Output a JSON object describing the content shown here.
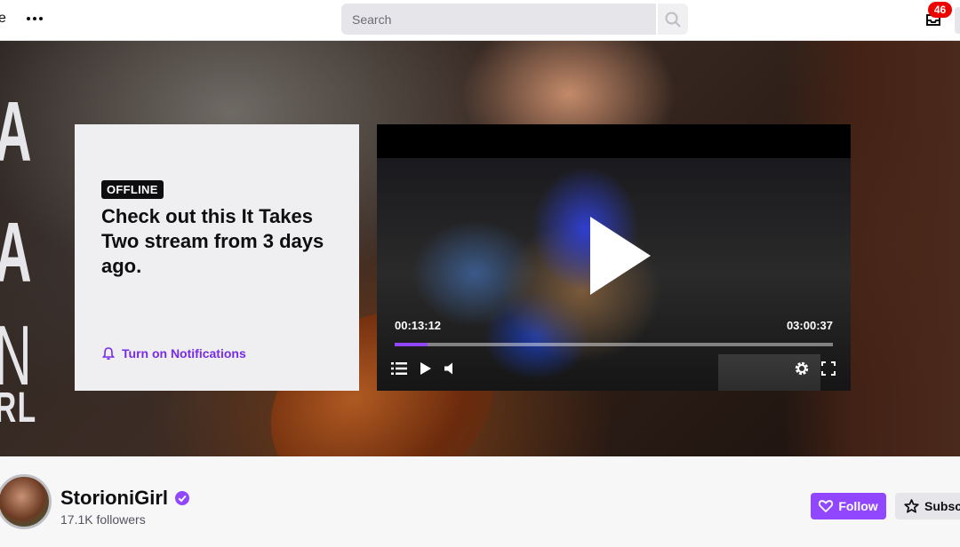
{
  "topbar": {
    "left_edge_glyph": "e",
    "search_placeholder": "Search",
    "inbox_count": "46"
  },
  "banner": {
    "lines": [
      "A",
      "A",
      "N",
      "RL"
    ]
  },
  "offline_card": {
    "badge": "OFFLINE",
    "headline": "Check out this It Takes Two stream from 3 days ago.",
    "notifications_label": "Turn on Notifications"
  },
  "player": {
    "current_time": "00:13:12",
    "duration": "03:00:37",
    "progress": 0.075
  },
  "channel": {
    "name": "StorioniGirl",
    "followers": "17.1K followers",
    "follow_label": "Follow",
    "subscribe_label": "Subsc"
  },
  "colors": {
    "accent": "#9147ff",
    "link": "#772ce8",
    "badge_red": "#eb0400"
  }
}
